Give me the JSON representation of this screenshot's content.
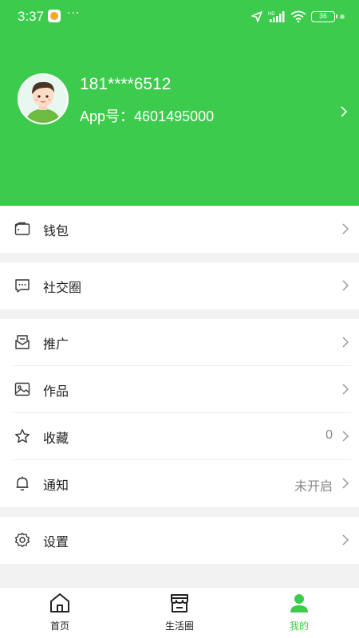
{
  "status_bar": {
    "time": "3:37",
    "more": "···",
    "battery": "36"
  },
  "profile": {
    "phone": "181****6512",
    "app_id_label": "App号：",
    "app_id": "4601495000"
  },
  "menu": {
    "wallet": {
      "label": "钱包"
    },
    "social": {
      "label": "社交圈"
    },
    "promote": {
      "label": "推广"
    },
    "works": {
      "label": "作品"
    },
    "favorites": {
      "label": "收藏",
      "value": "0"
    },
    "notice": {
      "label": "通知",
      "value": "未开启"
    },
    "settings": {
      "label": "设置"
    }
  },
  "tabbar": {
    "home": "首页",
    "life": "生活圈",
    "mine": "我的"
  },
  "colors": {
    "accent": "#3ccb4c",
    "background": "#f2f2f2"
  },
  "icons": {
    "wallet": "wallet-icon",
    "social": "chat-bubble-icon",
    "promote": "mail-icon",
    "works": "image-icon",
    "favorites": "star-icon",
    "notice": "bell-icon",
    "settings": "gear-icon",
    "home": "home-icon",
    "life": "store-icon",
    "mine": "person-icon"
  }
}
